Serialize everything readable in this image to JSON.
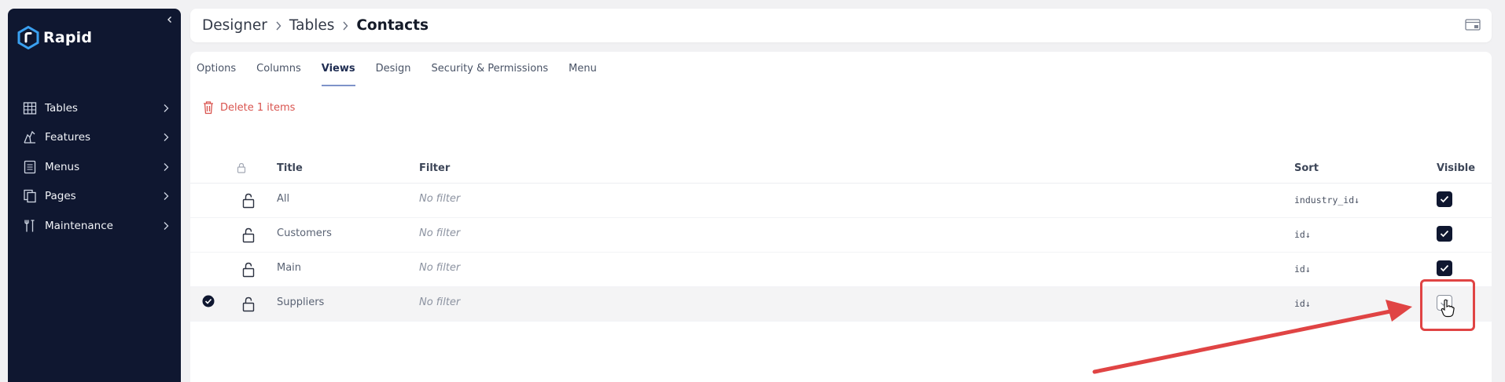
{
  "sidebar": {
    "brand": "Rapid",
    "items": [
      {
        "label": "Tables",
        "icon": "table-icon"
      },
      {
        "label": "Features",
        "icon": "features-icon"
      },
      {
        "label": "Menus",
        "icon": "menu-icon"
      },
      {
        "label": "Pages",
        "icon": "pages-icon"
      },
      {
        "label": "Maintenance",
        "icon": "maintenance-icon"
      }
    ]
  },
  "header": {
    "breadcrumb": [
      "Designer",
      "Tables",
      "Contacts"
    ]
  },
  "tabs": [
    "Options",
    "Columns",
    "Views",
    "Design",
    "Security & Permissions",
    "Menu"
  ],
  "active_tab": "Views",
  "toolbar": {
    "delete_label": "Delete 1 items"
  },
  "table": {
    "columns": {
      "title": "Title",
      "filter": "Filter",
      "sort": "Sort",
      "visible": "Visible"
    },
    "rows": [
      {
        "title": "All",
        "filter": "No filter",
        "sort": "industry_id↓",
        "visible": true,
        "selected": false
      },
      {
        "title": "Customers",
        "filter": "No filter",
        "sort": "id↓",
        "visible": true,
        "selected": false
      },
      {
        "title": "Main",
        "filter": "No filter",
        "sort": "id↓",
        "visible": true,
        "selected": false
      },
      {
        "title": "Suppliers",
        "filter": "No filter",
        "sort": "id↓",
        "visible": false,
        "selected": true
      }
    ]
  },
  "colors": {
    "sidebar_bg": "#0f1730",
    "accent": "#7e93c9",
    "danger": "#d9544f",
    "annotation": "#e04444"
  }
}
